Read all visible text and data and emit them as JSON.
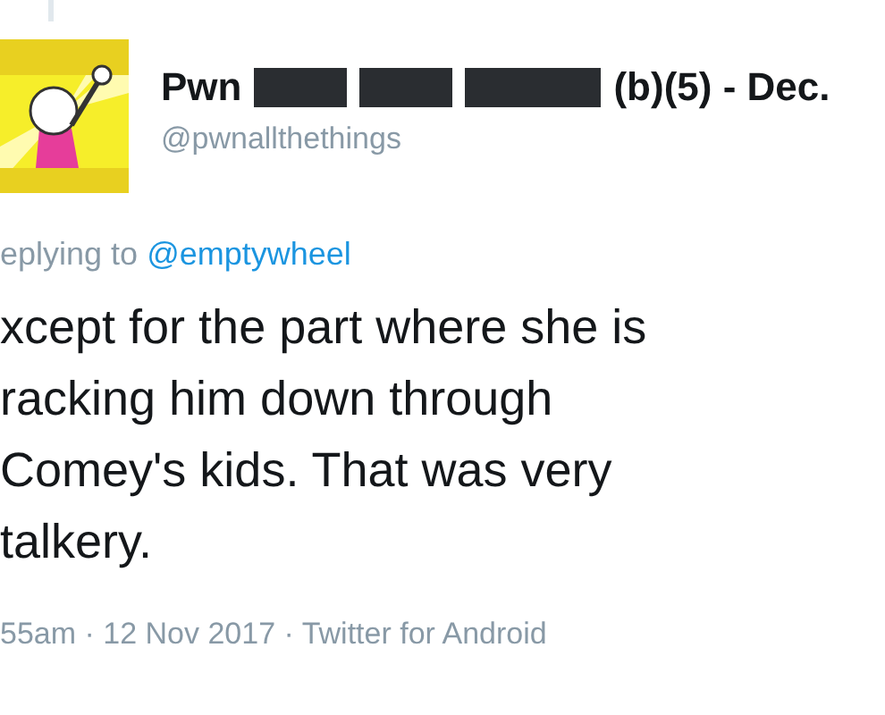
{
  "author": {
    "name_parts": [
      {
        "kind": "text",
        "text": "Pwn"
      },
      {
        "kind": "redaction"
      },
      {
        "kind": "redaction"
      },
      {
        "kind": "redaction"
      },
      {
        "kind": "text",
        "text": "(b)(5) - Dec."
      }
    ],
    "handle": "@pwnallthethings"
  },
  "reply": {
    "label": "eplying to",
    "mention": "@emptywheel"
  },
  "tweet_lines": [
    "xcept for the part where she is",
    "racking him down through",
    "Comey's kids. That was very",
    "talkery."
  ],
  "footer": "55am · 12 Nov 2017 · Twitter for Android"
}
